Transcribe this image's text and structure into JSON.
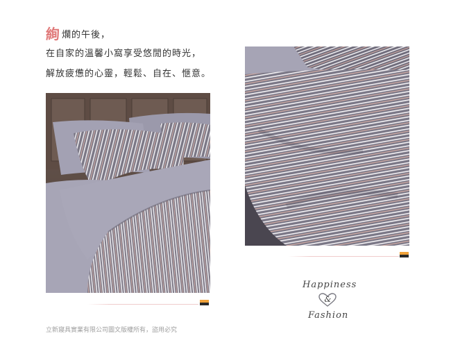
{
  "intro": {
    "first_char": "絢",
    "line1_rest": "爛的午後，",
    "line2": "在自家的溫馨小窩享受悠閒的時光，",
    "line3": "解放疲憊的心靈，輕鬆、自在、愜意。"
  },
  "tagline": {
    "word1": "Happiness",
    "ampersand": "&",
    "word2": "Fashion"
  },
  "footer": {
    "copyright": "立新寢具實業有限公司圖文版權所有，盜用必究"
  },
  "colors": {
    "accent_red": "#e07a7a",
    "mark_orange": "#f0a23a",
    "mark_dark": "#2a2a2a",
    "heart_gray": "#7a7a82"
  }
}
